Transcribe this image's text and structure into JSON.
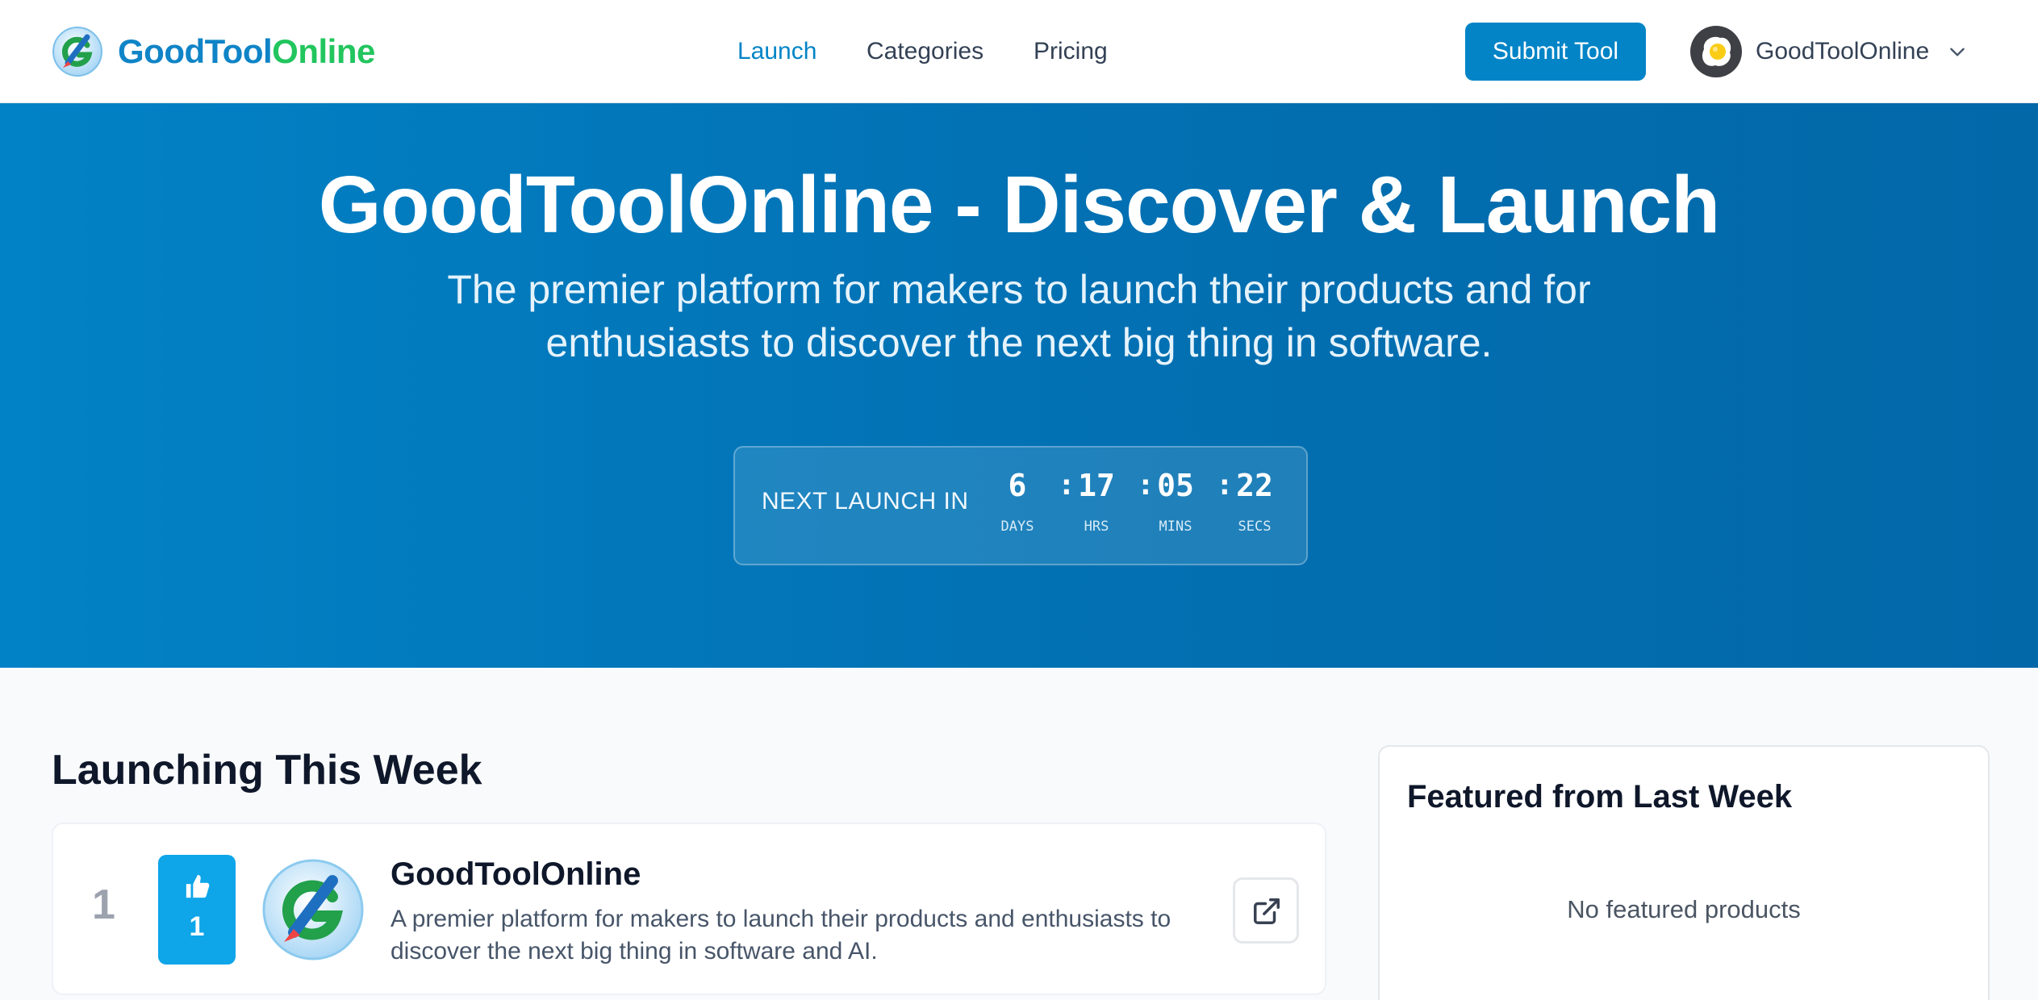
{
  "brand": {
    "name_part1": "GoodTool",
    "name_part2": "Online",
    "logo_icon": "goodtoolonline-logo-icon"
  },
  "nav": {
    "items": [
      {
        "label": "Launch",
        "active": true
      },
      {
        "label": "Categories",
        "active": false
      },
      {
        "label": "Pricing",
        "active": false
      }
    ]
  },
  "header": {
    "submit_label": "Submit Tool",
    "user_name": "GoodToolOnline",
    "user_avatar_icon": "egg-avatar-icon",
    "menu_icon": "chevron-down-icon"
  },
  "hero": {
    "title": "GoodToolOnline - Discover & Launch",
    "subtitle_line1": "The premier platform for makers to launch their products and for",
    "subtitle_line2": "enthusiasts to discover the next big thing in software."
  },
  "countdown": {
    "label": "NEXT LAUNCH IN",
    "days": "6",
    "days_label": "DAYS",
    "hours": "17",
    "hours_label": "HRS",
    "mins": "05",
    "mins_label": "MINS",
    "secs": "22",
    "secs_label": "SECS",
    "separator": ":"
  },
  "launching": {
    "title": "Launching This Week",
    "products": [
      {
        "rank": "1",
        "votes": "1",
        "name": "GoodToolOnline",
        "description_line1": "A premier platform for makers to launch their products and enthusiasts to",
        "description_line2": "discover the next big thing in software and AI.",
        "upvote_icon": "thumbs-up-icon",
        "link_icon": "external-link-icon"
      }
    ]
  },
  "featured": {
    "title": "Featured from Last Week",
    "empty_text": "No featured products"
  },
  "colors": {
    "primary": "#0284c7",
    "brand_green": "#22c55e",
    "upvote": "#0ea5e9",
    "hero_start": "#0282c6",
    "hero_end": "#0368a8"
  }
}
